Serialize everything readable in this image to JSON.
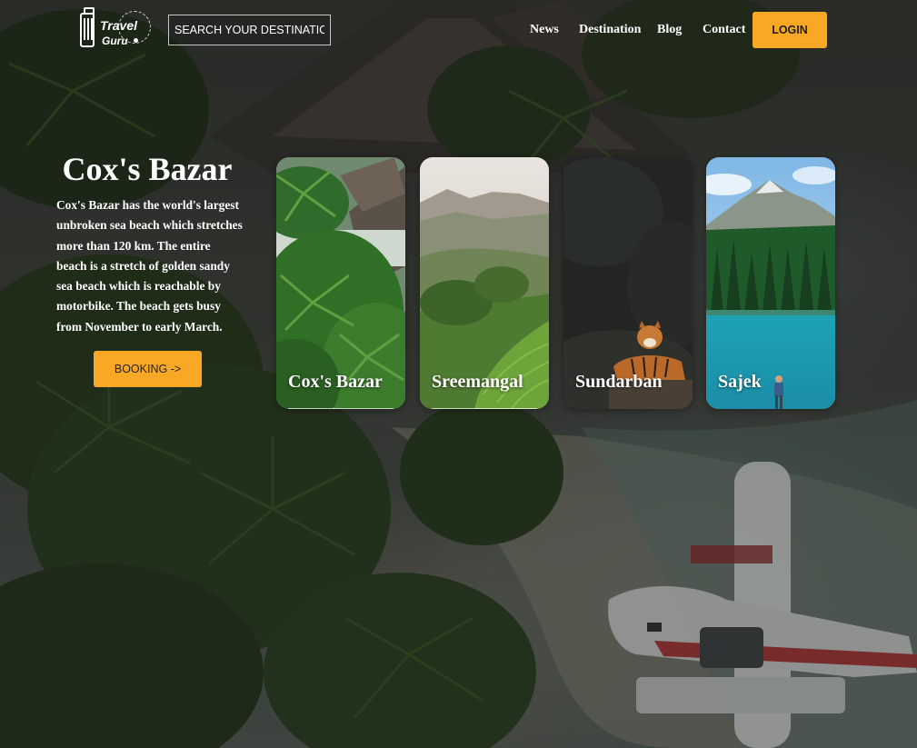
{
  "brand": {
    "line1": "Travel",
    "line2": "Guru"
  },
  "search": {
    "placeholder": "SEARCH YOUR DESTINATION"
  },
  "nav": {
    "items": [
      "News",
      "Destination",
      "Blog",
      "Contact"
    ],
    "login_label": "LOGIN"
  },
  "hero": {
    "title": "Cox's Bazar",
    "description": "Cox's Bazar has the world's largest unbroken sea beach which stretches more than 120 km. The entire beach is a stretch of golden sandy sea beach which is reachable by motorbike. The beach gets busy from November to early March.",
    "booking_label": "BOOKING ->"
  },
  "cards": [
    {
      "label": "Cox's Bazar"
    },
    {
      "label": "Sreemangal"
    },
    {
      "label": "Sundarban"
    },
    {
      "label": "Sajek"
    }
  ],
  "colors": {
    "accent": "#f9a826",
    "text": "#ffffff"
  }
}
